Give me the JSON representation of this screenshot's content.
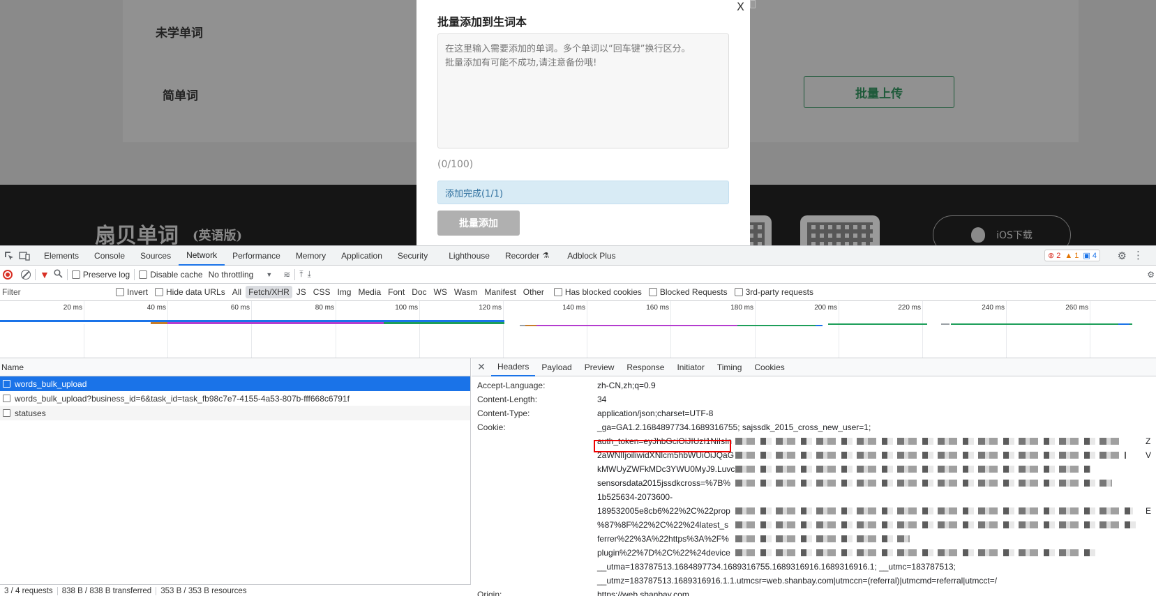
{
  "page": {
    "row_labels": [
      "未学单词",
      "简单词"
    ],
    "upload_button": "批量上传",
    "footer_brand": "扇贝单词",
    "footer_brand_sub": "(英语版)",
    "ios_download": "iOS下载"
  },
  "modal": {
    "close": "X",
    "title": "批量添加到生词本",
    "textarea_placeholder": "在这里输入需要添加的单词。多个单词以“回车键”换行区分。\n批量添加有可能不成功,请注意备份哦!",
    "count": "(0/100)",
    "success_text": "添加完成(1/1)",
    "submit": "批量添加"
  },
  "devtools": {
    "tabs": [
      "Elements",
      "Console",
      "Sources",
      "Network",
      "Performance",
      "Memory",
      "Application",
      "Security",
      "Lighthouse",
      "Recorder",
      "Adblock Plus"
    ],
    "active_tab": "Network",
    "badges": {
      "errors": "2",
      "warnings": "1",
      "messages": "4"
    },
    "toolbar": {
      "preserve_log": "Preserve log",
      "disable_cache": "Disable cache",
      "throttling": "No throttling"
    },
    "filter": {
      "placeholder": "Filter",
      "invert": "Invert",
      "hide_data_urls": "Hide data URLs",
      "types": [
        "All",
        "Fetch/XHR",
        "JS",
        "CSS",
        "Img",
        "Media",
        "Font",
        "Doc",
        "WS",
        "Wasm",
        "Manifest",
        "Other"
      ],
      "active_type": "Fetch/XHR",
      "has_blocked_cookies": "Has blocked cookies",
      "blocked_requests": "Blocked Requests",
      "third_party": "3rd-party requests"
    },
    "timeline": {
      "ticks": [
        "20 ms",
        "40 ms",
        "60 ms",
        "80 ms",
        "100 ms",
        "120 ms",
        "140 ms",
        "160 ms",
        "180 ms",
        "200 ms",
        "220 ms",
        "240 ms",
        "260 ms"
      ]
    },
    "requests": {
      "column_name": "Name",
      "rows": [
        "words_bulk_upload",
        "words_bulk_upload?business_id=6&task_id=task_fb98c7e7-4155-4a53-807b-fff668c6791f",
        "statuses"
      ],
      "selected_index": 0,
      "status": [
        "3 / 4 requests",
        "838 B / 838 B transferred",
        "353 B / 353 B resources"
      ]
    },
    "detail": {
      "tabs": [
        "Headers",
        "Payload",
        "Preview",
        "Response",
        "Initiator",
        "Timing",
        "Cookies"
      ],
      "active_tab": "Headers",
      "headers": [
        {
          "name": "Accept-Language:",
          "value": "zh-CN,zh;q=0.9"
        },
        {
          "name": "Content-Length:",
          "value": "34"
        },
        {
          "name": "Content-Type:",
          "value": "application/json;charset=UTF-8"
        },
        {
          "name": "Cookie:",
          "value": "_ga=GA1.2.1684897734.1689316755; sajssdk_2015_cross_new_user=1;"
        }
      ],
      "cookie_lines": [
        "auth_token=eyJhbGciOiJIUzI1NiIsIn",
        "2aWNlIjoiliwidXNlcm5hbWUiOiJQaG",
        "kMWUyZWFkMDc3YWU0MyJ9.Luvc",
        "sensorsdata2015jssdkcross=%7B%",
        "1b525634-2073600-",
        "189532005e8cb6%22%2C%22prop",
        "%87%8F%22%2C%22%24latest_s",
        "ferrer%22%3A%22https%3A%2F%",
        "plugin%22%7D%2C%22%24device",
        "__utma=183787513.1684897734.1689316755.1689316916.1689316916.1; __utmc=183787513;",
        "__utmz=183787513.1689316916.1.1.utmcsr=web.shanbay.com|utmccn=(referral)|utmcmd=referral|utmcct=/"
      ],
      "bottom_name": "Origin:",
      "bottom_value": "https://web.shanbay.com",
      "cut_chars": [
        "Z",
        "V",
        "E"
      ]
    }
  }
}
